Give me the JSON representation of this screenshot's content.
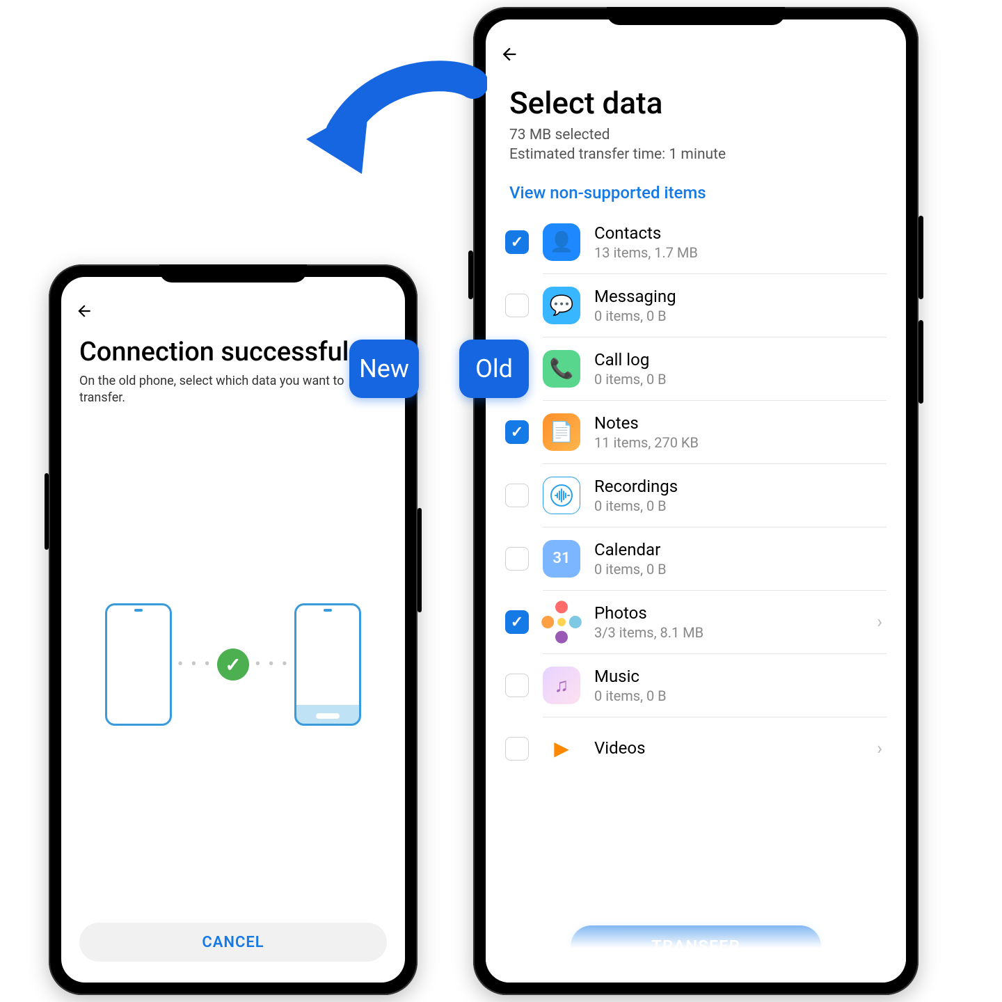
{
  "arrow_color": "#1566e0",
  "badges": {
    "new": "New",
    "old": "Old"
  },
  "left_phone": {
    "title": "Connection successful",
    "subtitle": "On the old phone, select which data you want to transfer.",
    "cancel": "CANCEL"
  },
  "right_phone": {
    "title": "Select data",
    "selected_line": "73 MB selected",
    "eta_line": "Estimated transfer time: 1 minute",
    "link": "View non-supported items",
    "transfer": "TRANSFER",
    "items": [
      {
        "id": "contacts",
        "title": "Contacts",
        "sub": "13 items, 1.7 MB",
        "checked": true,
        "chevron": false,
        "icon_text": "👤"
      },
      {
        "id": "messaging",
        "title": "Messaging",
        "sub": "0 items, 0 B",
        "checked": false,
        "chevron": false,
        "icon_text": "💬"
      },
      {
        "id": "calllog",
        "title": "Call log",
        "sub": "0 items, 0 B",
        "checked": false,
        "chevron": false,
        "icon_text": "📞"
      },
      {
        "id": "notes",
        "title": "Notes",
        "sub": "11 items, 270 KB",
        "checked": true,
        "chevron": false,
        "icon_text": "📄"
      },
      {
        "id": "recordings",
        "title": "Recordings",
        "sub": "0 items, 0 B",
        "checked": false,
        "chevron": false,
        "icon_text": "●"
      },
      {
        "id": "calendar",
        "title": "Calendar",
        "sub": "0 items, 0 B",
        "checked": false,
        "chevron": false,
        "icon_text": "31"
      },
      {
        "id": "photos",
        "title": "Photos",
        "sub": "3/3 items, 8.1 MB",
        "checked": true,
        "chevron": true,
        "icon_text": ""
      },
      {
        "id": "music",
        "title": "Music",
        "sub": "0 items, 0 B",
        "checked": false,
        "chevron": false,
        "icon_text": "♫"
      },
      {
        "id": "videos",
        "title": "Videos",
        "sub": "",
        "checked": false,
        "chevron": true,
        "icon_text": "▶"
      }
    ]
  }
}
